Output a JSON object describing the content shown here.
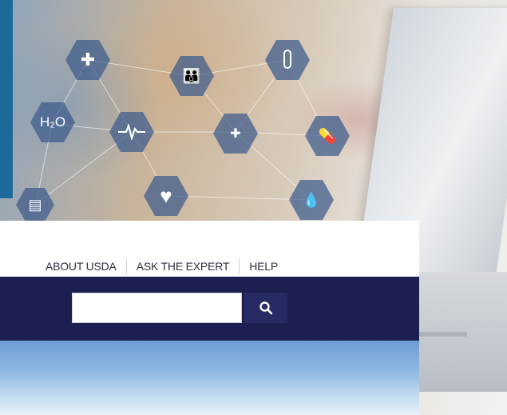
{
  "background": {
    "hex_icons": [
      {
        "name": "medical-cross-icon",
        "glyph": "✚"
      },
      {
        "name": "family-icon",
        "glyph": "👪"
      },
      {
        "name": "test-tube-icon",
        "glyph": "🧪"
      },
      {
        "name": "h2o-icon",
        "label": "H₂O"
      },
      {
        "name": "heartbeat-icon",
        "glyph": "〰"
      },
      {
        "name": "first-aid-icon",
        "glyph": "✚"
      },
      {
        "name": "pills-icon",
        "glyph": "💊"
      },
      {
        "name": "clipboard-icon",
        "glyph": "▤"
      },
      {
        "name": "heart-icon",
        "glyph": "♥"
      },
      {
        "name": "drops-icon",
        "glyph": "💧"
      }
    ]
  },
  "utility_nav": {
    "items": [
      {
        "label": "ABOUT USDA"
      },
      {
        "label": "ASK THE EXPERT"
      },
      {
        "label": "HELP"
      }
    ]
  },
  "search": {
    "value": "",
    "placeholder": "",
    "button_icon": "search-icon"
  },
  "colors": {
    "navy_bar": "#1c2050",
    "search_button": "#262b63",
    "accent_strip": "#1c6a9a"
  }
}
